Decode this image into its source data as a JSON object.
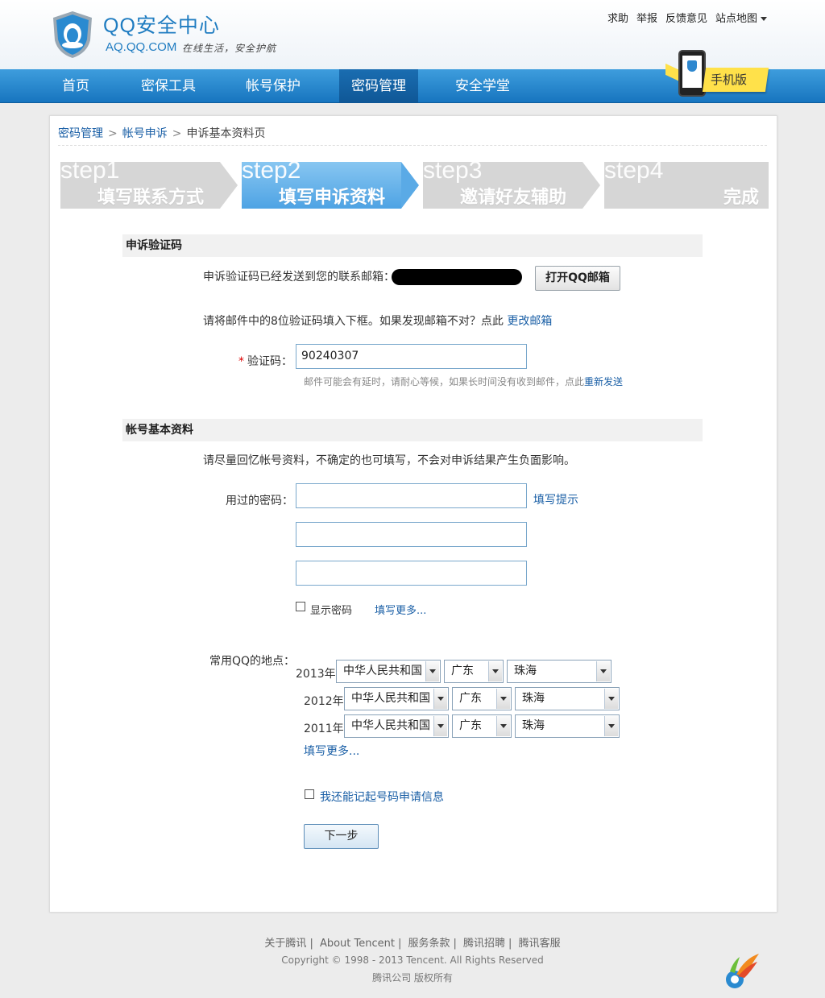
{
  "header": {
    "title": "QQ安全中心",
    "domain": "AQ.QQ.COM",
    "slogan": "在线生活，安全护航",
    "top_links": [
      "求助",
      "举报",
      "反馈意见",
      "站点地图"
    ],
    "mobile_badge": "手机版"
  },
  "nav": {
    "items": [
      "首页",
      "密保工具",
      "帐号保护",
      "密码管理",
      "安全学堂"
    ],
    "active": "密码管理"
  },
  "breadcrumb": [
    "密码管理",
    "帐号申诉",
    "申诉基本资料页"
  ],
  "steps": [
    {
      "num": "step1",
      "label": "填写联系方式"
    },
    {
      "num": "step2",
      "label": "填写申诉资料"
    },
    {
      "num": "step3",
      "label": "邀请好友辅助"
    },
    {
      "num": "step4",
      "label": "完成"
    }
  ],
  "verify_section": {
    "title": "申诉验证码",
    "sent_text": "申诉验证码已经发送到您的联系邮箱：",
    "open_mail_button": "打开QQ邮箱",
    "instruction": "请将邮件中的8位验证码填入下框。如果发现邮箱不对？点此",
    "change_email_link": "更改邮箱",
    "code_label": "验证码：",
    "code_value": "90240307",
    "delay_hint": "邮件可能会有延时，请耐心等候，如果长时间没有收到邮件，点此",
    "resend_link": "重新发送"
  },
  "account_section": {
    "title": "帐号基本资料",
    "intro": "请尽量回忆帐号资料，不确定的也可填写，不会对申诉结果产生负面影响。",
    "password_label": "用过的密码：",
    "fill_hint_link": "填写提示",
    "show_password_label": "显示密码",
    "more_passwords_link": "填写更多...",
    "location_label": "常用QQ的地点：",
    "locations": [
      {
        "year": "2013年",
        "country": "中华人民共和国",
        "province": "广东",
        "city": "珠海"
      },
      {
        "year": "2012年",
        "country": "中华人民共和国",
        "province": "广东",
        "city": "珠海"
      },
      {
        "year": "2011年",
        "country": "中华人民共和国",
        "province": "广东",
        "city": "珠海"
      }
    ],
    "more_locations_link": "填写更多...",
    "remember_label": "我还能记起号码申请信息",
    "next_button": "下一步"
  },
  "footer": {
    "links": [
      "关于腾讯",
      "About Tencent",
      "服务条款",
      "腾讯招聘",
      "腾讯客服"
    ],
    "copyright": "Copyright © 1998 - 2013 Tencent. All Rights Reserved",
    "company": "腾讯公司 版权所有"
  },
  "colors": {
    "brand_blue": "#1f7cc1",
    "nav_blue": "#2a8ad0",
    "step_active": "#5aaae6",
    "link": "#1a5fa6"
  }
}
